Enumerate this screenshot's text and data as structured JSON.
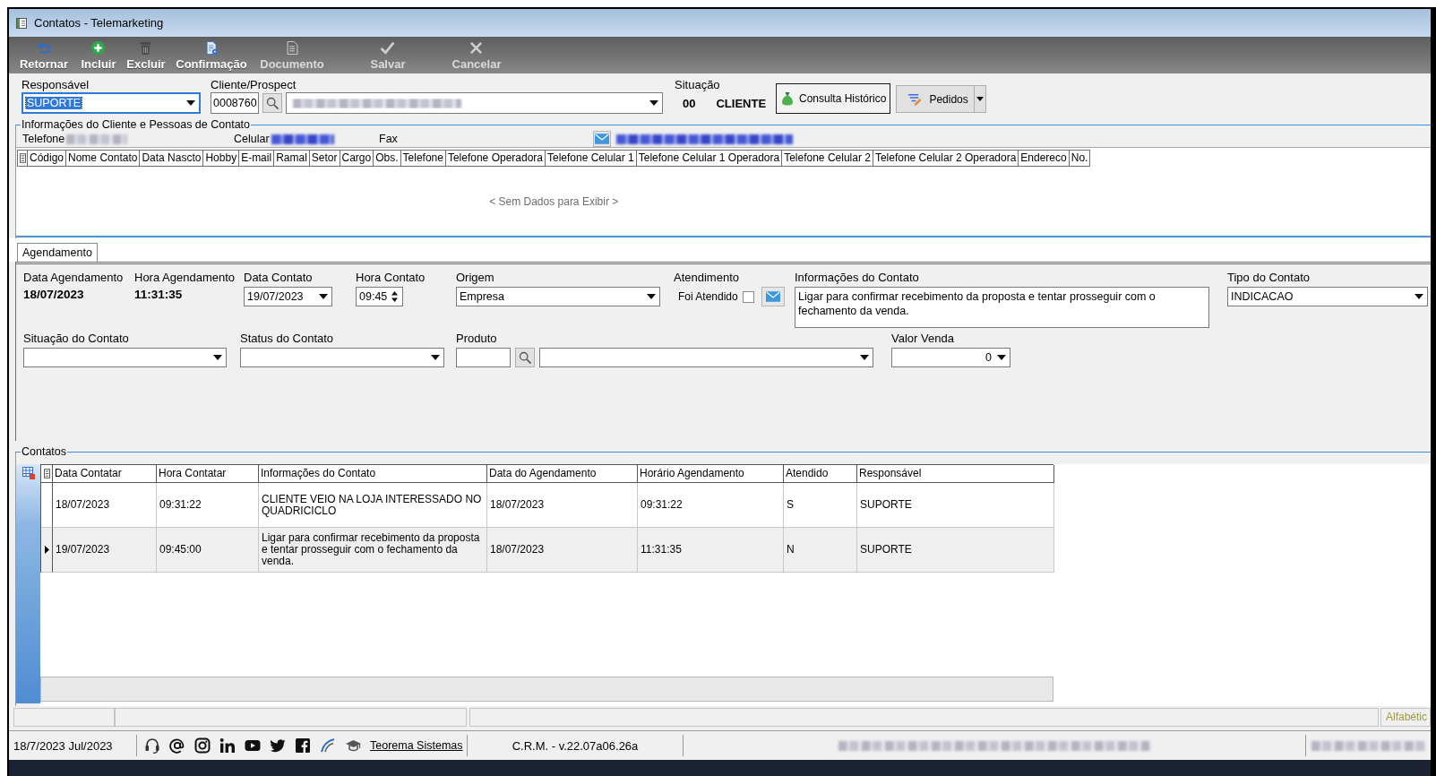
{
  "window": {
    "title": "Contatos - Telemarketing"
  },
  "toolbar": [
    {
      "label": "Retornar",
      "disabled": false
    },
    {
      "label": "Incluir",
      "disabled": false
    },
    {
      "label": "Excluir",
      "disabled": false
    },
    {
      "label": "Confirmação",
      "disabled": false
    },
    {
      "label": "Documento",
      "disabled": true
    },
    {
      "label": "Salvar",
      "disabled": true
    },
    {
      "label": "Cancelar",
      "disabled": true
    }
  ],
  "header": {
    "responsavel": {
      "label": "Responsável",
      "value": "SUPORTE",
      "focused": true
    },
    "cliente": {
      "label": "Cliente/Prospect",
      "code": "0008760"
    },
    "situacao": {
      "label": "Situação",
      "code": "00",
      "value": "CLIENTE"
    },
    "buttons": [
      {
        "label": "Consulta Histórico",
        "kind": "default"
      },
      {
        "label": "Pedidos",
        "kind": "split"
      }
    ]
  },
  "client_info": {
    "title": "Informações do Cliente e Pessoas de Contato",
    "fields": [
      {
        "label": "Telefone"
      },
      {
        "label": "Celular"
      },
      {
        "label": "Fax"
      }
    ],
    "grid": {
      "columns": [
        "Código",
        "Nome Contato",
        "Data Nascto",
        "Hobby",
        "E-mail",
        "Ramal",
        "Setor",
        "Cargo",
        "Obs.",
        "Telefone",
        "Telefone Operadora",
        "Telefone Celular 1",
        "Telefone Celular 1 Operadora",
        "Telefone Celular 2",
        "Telefone Celular 2 Operadora",
        "Endereco",
        "No."
      ],
      "empty_text": "< Sem Dados para Exibir >"
    }
  },
  "tabs": [
    {
      "label": "Agendamento",
      "selected": true
    }
  ],
  "schedule": {
    "data_agendamento": {
      "label": "Data Agendamento",
      "value": "18/07/2023"
    },
    "hora_agendamento": {
      "label": "Hora Agendamento",
      "value": "11:31:35"
    },
    "data_contato": {
      "label": "Data Contato",
      "value": "19/07/2023"
    },
    "hora_contato": {
      "label": "Hora Contato",
      "value": "09:45"
    },
    "origem": {
      "label": "Origem",
      "value": "Empresa"
    },
    "atendimento": {
      "label": "Atendimento",
      "option": "Foi Atendido",
      "checked": false
    },
    "informacoes": {
      "label": "Informações do Contato",
      "value": "Ligar para confirmar recebimento da proposta e tentar prosseguir com o fechamento da venda."
    },
    "tipo": {
      "label": "Tipo do Contato",
      "value": "INDICACAO"
    },
    "situacao": {
      "label": "Situação do Contato"
    },
    "status": {
      "label": "Status do Contato"
    },
    "produto": {
      "label": "Produto"
    },
    "valor_venda": {
      "label": "Valor Venda",
      "value": "0"
    }
  },
  "contacts": {
    "title": "Contatos",
    "columns": [
      "Data Contatar",
      "Hora Contatar",
      "Informações do Contato",
      "Data do Agendamento",
      "Horário Agendamento",
      "Atendido",
      "Responsável"
    ],
    "rows": [
      {
        "selected": false,
        "cells": [
          "18/07/2023",
          "09:31:22",
          "CLIENTE VEIO NA LOJA INTERESSADO NO QUADRICICLO",
          "18/07/2023",
          "09:31:22",
          "S",
          "SUPORTE"
        ]
      },
      {
        "selected": true,
        "cells": [
          "19/07/2023",
          "09:45:00",
          "Ligar para confirmar recebimento da proposta e tentar prosseguir com o fechamento da venda.",
          "18/07/2023",
          "11:31:35",
          "N",
          "SUPORTE"
        ]
      }
    ]
  },
  "status_bar": {
    "order": "Alfabétic"
  },
  "bottom_bar": {
    "date": "18/7/2023 Jul/2023",
    "link": "Teorema Sistemas",
    "version": "C.R.M. - v.22.07a06.26a"
  }
}
